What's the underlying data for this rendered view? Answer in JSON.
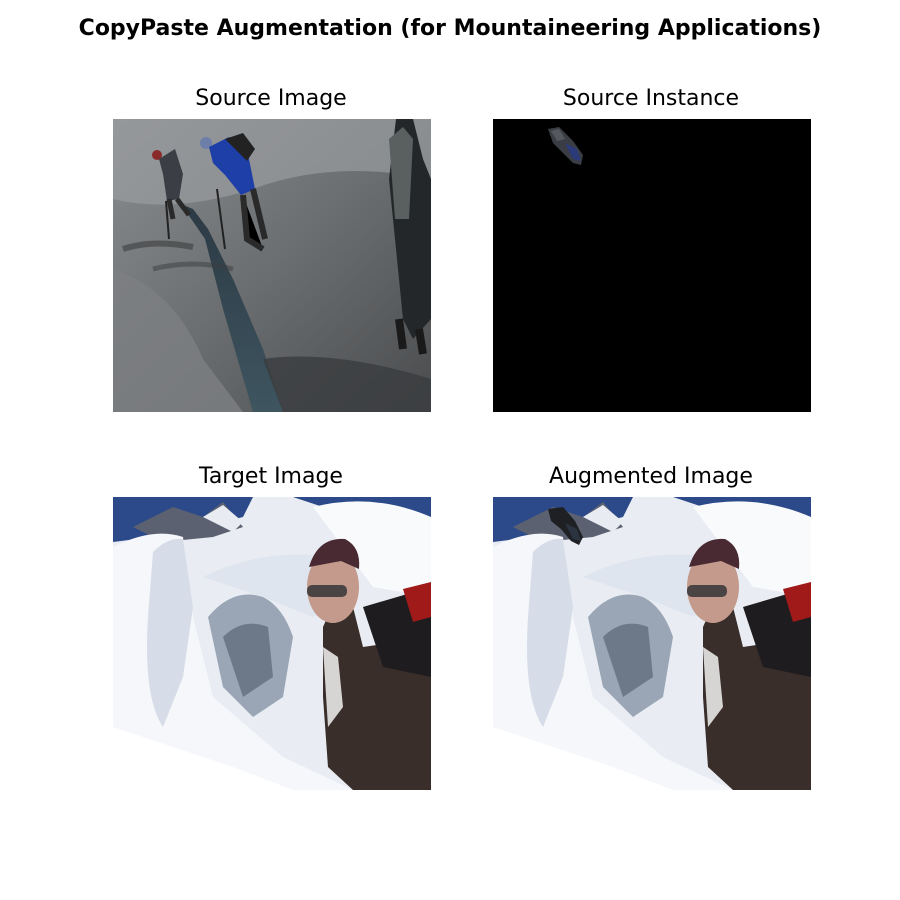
{
  "figure": {
    "title": "CopyPaste Augmentation (for Mountaineering Applications)"
  },
  "panels": {
    "source_image": {
      "title": "Source Image"
    },
    "source_instance": {
      "title": "Source Instance"
    },
    "target_image": {
      "title": "Target Image"
    },
    "augmented_image": {
      "title": "Augmented Image"
    }
  },
  "colors": {
    "background": "#ffffff",
    "mask_background": "#000000",
    "glacier_shadow": "#5d6062",
    "snow": "#eef2f7",
    "sky": "#2c4a8a"
  }
}
